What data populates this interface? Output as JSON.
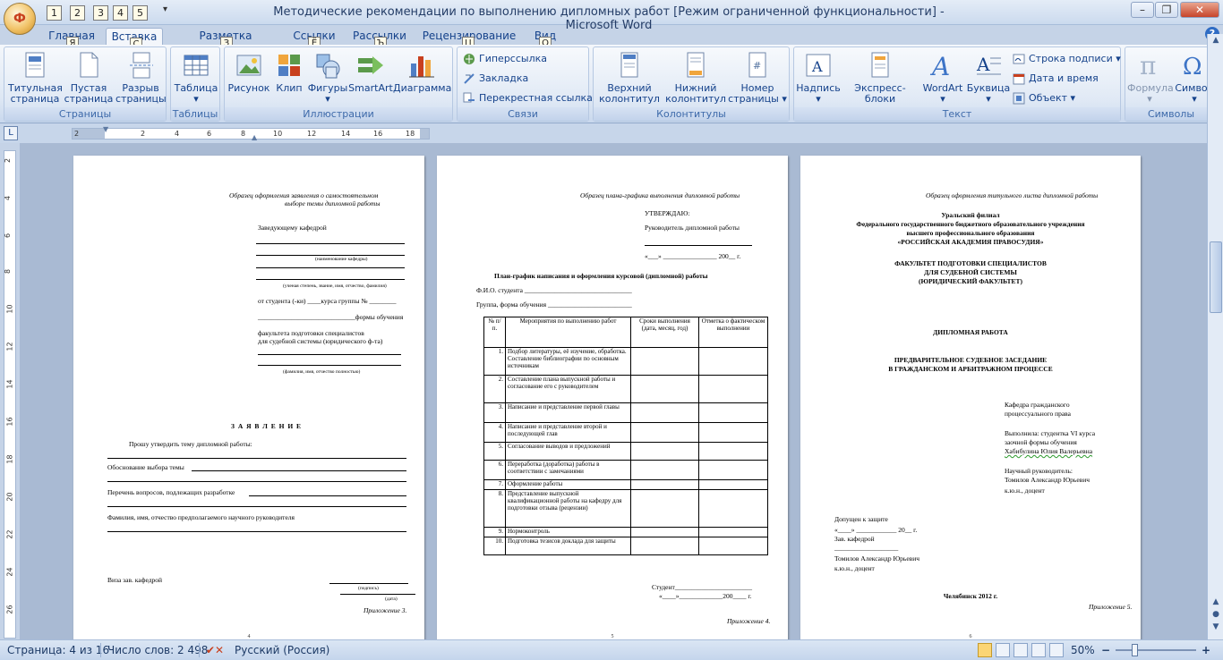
{
  "window": {
    "title": "Методические рекомендации по выполнению дипломных работ [Режим ограниченной функциональности] - Microsoft Word",
    "office_button_key": "Ф",
    "qat_keys": [
      "1",
      "2",
      "3",
      "4",
      "5"
    ],
    "controls": {
      "minimize": "–",
      "restore": "❐",
      "close": "✕"
    }
  },
  "tabs": [
    {
      "label": "Главная",
      "key": "Я"
    },
    {
      "label": "Вставка",
      "key": "С",
      "active": true
    },
    {
      "label": "Разметка страницы",
      "key": "З"
    },
    {
      "label": "Ссылки",
      "key": "Ё"
    },
    {
      "label": "Рассылки",
      "key": "Ъ"
    },
    {
      "label": "Рецензирование",
      "key": "Ц"
    },
    {
      "label": "Вид",
      "key": "О"
    }
  ],
  "ribbon": {
    "groups": {
      "pages": "Страницы",
      "tables": "Таблицы",
      "illustrations": "Иллюстрации",
      "links": "Связи",
      "headers": "Колонтитулы",
      "text": "Текст",
      "symbols": "Символы"
    },
    "buttons": {
      "cover_page": [
        "Титульная",
        "страница ▾"
      ],
      "blank_page": [
        "Пустая",
        "страница"
      ],
      "page_break": [
        "Разрыв",
        "страницы"
      ],
      "table": [
        "Таблица",
        "▾"
      ],
      "picture": "Рисунок",
      "clip": "Клип",
      "shapes": [
        "Фигуры",
        "▾"
      ],
      "smartart": "SmartArt",
      "chart": "Диаграмма",
      "hyperlink": "Гиперссылка",
      "bookmark": "Закладка",
      "cross_ref": "Перекрестная ссылка",
      "header": [
        "Верхний",
        "колонтитул ▾"
      ],
      "footer": [
        "Нижний",
        "колонтитул ▾"
      ],
      "page_number": [
        "Номер",
        "страницы ▾"
      ],
      "textbox": [
        "Надпись",
        "▾"
      ],
      "quickparts": [
        "Экспресс-блоки",
        "▾"
      ],
      "wordart": [
        "WordArt",
        "▾"
      ],
      "dropcap": [
        "Буквица",
        "▾"
      ],
      "signature_line": "Строка подписи ▾",
      "date_time": "Дата и время",
      "object": "Объект ▾",
      "equation": [
        "Формула",
        "▾"
      ],
      "symbol": [
        "Символ",
        "▾"
      ]
    }
  },
  "ruler": {
    "ticks": [
      "2",
      "2",
      "4",
      "6",
      "8",
      "10",
      "12",
      "14",
      "16",
      "18"
    ],
    "vticks": [
      "2",
      "4",
      "6",
      "8",
      "10",
      "12",
      "14",
      "16",
      "18",
      "20",
      "22",
      "24",
      "26"
    ]
  },
  "pages": {
    "p4": {
      "header": "Образец оформления заявления о самостоятельном",
      "header2": "выборе темы дипломной работы",
      "to": "Заведующему кафедрой",
      "dept_hint": "(наименование кафедры)",
      "rank_hint": "(ученая степень, звание, имя, отчество, фамилия)",
      "from": "от студента (-ки) ____курса группы № ________",
      "form": "_____________________________формы обучения",
      "faculty1": "факультета подготовки специалистов",
      "faculty2": "для судебной системы (юридического ф-та)",
      "name_hint": "(фамилия, имя, отчество полностью)",
      "title": "З А Я В Л Е Н И Е",
      "request": "Прошу утвердить тему дипломной работы:",
      "reason": "Обоснование выбора темы",
      "questions": "Перечень вопросов, подлежащих разработке",
      "advisor": "Фамилия, имя, отчество предполагаемого научного руководителя",
      "visa": "Виза зав. кафедрой",
      "sign_hint": "(подпись)",
      "date_hint": "(дата)",
      "appendix": "Приложение 3.",
      "num": "4"
    },
    "p5": {
      "header": "Образец плана-графика выполнения дипломной работы",
      "approve": "УТВЕРЖДАЮ:",
      "supervisor": "Руководитель дипломной работы",
      "date_line": "«___» ________________ 200__ г.",
      "title": "План-график написания и оформления курсовой (дипломной) работы",
      "student": "Ф.И.О. студента ________________________________",
      "group": "Группа, форма обучения _________________________",
      "columns": [
        "№ п/п.",
        "Мероприятия по выполнению работ",
        "Сроки выполнения (дата, месяц, год)",
        "Отметка о фактическом выполнении"
      ],
      "rows": [
        {
          "n": "1.",
          "text": "Подбор литературы, её изучение, обработка. Составление библиографии по основным источникам"
        },
        {
          "n": "2.",
          "text": "Составление плана выпускной работы и согласование его с руководителем"
        },
        {
          "n": "3.",
          "text": "Написание и представление первой главы"
        },
        {
          "n": "4.",
          "text": "Написание и представление второй и последующей глав"
        },
        {
          "n": "5.",
          "text": "Согласование выводов и предложений"
        },
        {
          "n": "6.",
          "text": "Переработка (доработка) работы в соответствии с замечаниями"
        },
        {
          "n": "7.",
          "text": "Оформление работы"
        },
        {
          "n": "8.",
          "text": "Представление выпускной квалификационной работы на кафедру для подготовки отзыва (рецензии)"
        },
        {
          "n": "9.",
          "text": "Нормоконтроль"
        },
        {
          "n": "10.",
          "text": "Подготовка тезисов доклада для защиты"
        }
      ],
      "student_sign": "Студент_______________________",
      "student_date": "«____»_____________200____ г.",
      "appendix": "Приложение 4.",
      "num": "5"
    },
    "p6": {
      "header": "Образец оформления титульного листа дипломной работы",
      "org1": "Уральский филиал",
      "org2": "Федерального государственного бюджетного образовательного учреждения",
      "org3": "высшего профессионального образования",
      "org4": "«РОССИЙСКАЯ АКАДЕМИЯ ПРАВОСУДИЯ»",
      "fac1": "ФАКУЛЬТЕТ ПОДГОТОВКИ СПЕЦИАЛИСТОВ",
      "fac2": "ДЛЯ СУДЕБНОЙ СИСТЕМЫ",
      "fac3": "(ЮРИДИЧЕСКИЙ ФАКУЛЬТЕТ)",
      "work": "ДИПЛОМНАЯ РАБОТА",
      "topic1": "ПРЕДВАРИТЕЛЬНОЕ СУДЕБНОЕ ЗАСЕДАНИЕ",
      "topic2": "В ГРАЖДАНСКОМ И АРБИТРАЖНОМ ПРОЦЕССЕ",
      "dept1": "Кафедра гражданского",
      "dept2": "процессуального права",
      "done1": "Выполнила: студентка VI курса",
      "done2": "заочной формы обучения",
      "done3": "Хабибулина Юлия Валерьевна",
      "adv1": "Научный руководитель:",
      "adv2": "Томилов Александр Юрьевич",
      "adv3": "к.ю.н., доцент",
      "admit1": "Допущен к защите",
      "admit2": "«____» ____________ 20__ г.",
      "admit3": "Зав. кафедрой",
      "admit4": "___________________",
      "admit5": "Томилов Александр Юрьевич",
      "admit6": "к.ю.н., доцент",
      "city": "Челябинск 2012 г.",
      "appendix": "Приложение 5.",
      "num": "6"
    }
  },
  "status": {
    "page": "Страница: 4 из 16",
    "words": "Число слов: 2 498",
    "language": "Русский (Россия)",
    "zoom": "50%",
    "zoom_minus": "−",
    "zoom_plus": "+"
  }
}
